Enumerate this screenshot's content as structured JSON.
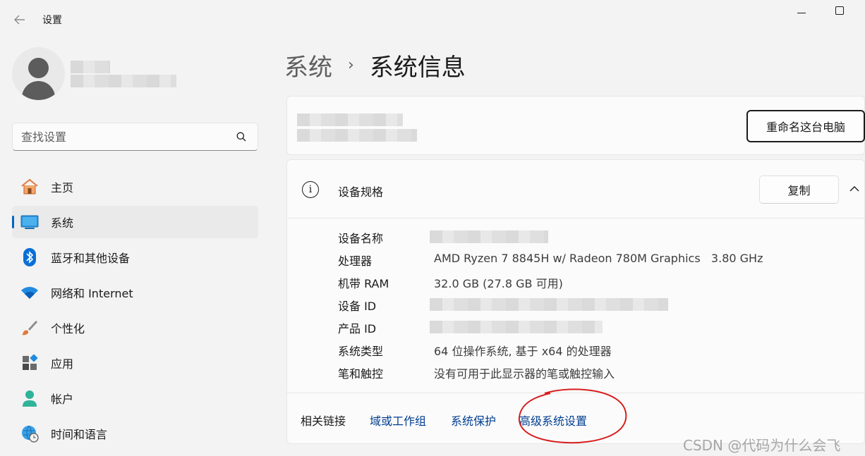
{
  "window": {
    "title": "设置"
  },
  "sidebar": {
    "search_placeholder": "查找设置",
    "items": [
      {
        "label": "主页",
        "icon": "home-icon"
      },
      {
        "label": "系统",
        "icon": "system-icon",
        "active": true
      },
      {
        "label": "蓝牙和其他设备",
        "icon": "bluetooth-icon"
      },
      {
        "label": "网络和 Internet",
        "icon": "wifi-icon"
      },
      {
        "label": "个性化",
        "icon": "brush-icon"
      },
      {
        "label": "应用",
        "icon": "apps-icon"
      },
      {
        "label": "帐户",
        "icon": "account-icon"
      },
      {
        "label": "时间和语言",
        "icon": "globe-clock-icon"
      }
    ]
  },
  "breadcrumb": {
    "parent": "系统",
    "separator": "›",
    "current": "系统信息"
  },
  "pc_card": {
    "rename_button": "重命名这台电脑"
  },
  "specs": {
    "title": "设备规格",
    "copy_button": "复制",
    "rows": [
      {
        "label": "设备名称",
        "value": ""
      },
      {
        "label": "处理器",
        "value": "AMD Ryzen 7 8845H w/ Radeon 780M Graphics   3.80 GHz"
      },
      {
        "label": "机带 RAM",
        "value": "32.0 GB (27.8 GB 可用)"
      },
      {
        "label": "设备 ID",
        "value": ""
      },
      {
        "label": "产品 ID",
        "value": ""
      },
      {
        "label": "系统类型",
        "value": "64 位操作系统, 基于 x64 的处理器"
      },
      {
        "label": "笔和触控",
        "value": "没有可用于此显示器的笔或触控输入"
      }
    ]
  },
  "related": {
    "label": "相关链接",
    "links": [
      "域或工作组",
      "系统保护",
      "高级系统设置"
    ]
  },
  "watermark": "CSDN @代码为什么会飞",
  "colors": {
    "accent": "#0067c0",
    "link": "#003e92",
    "annotation": "#d81e1e"
  }
}
